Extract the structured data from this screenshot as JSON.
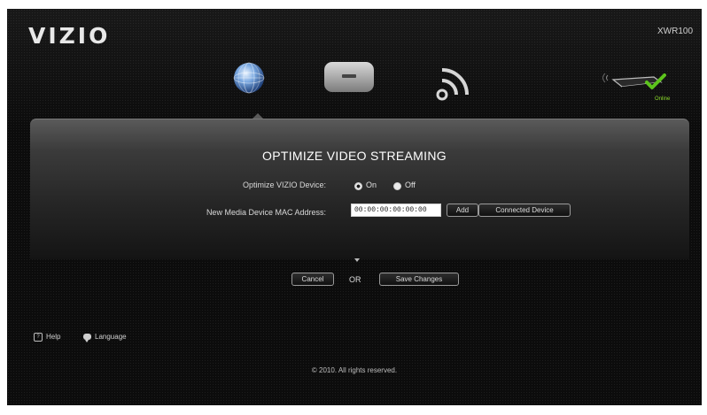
{
  "header": {
    "logo": "VIZIO",
    "model": "XWR100"
  },
  "nav": {
    "icons": [
      "globe-icon",
      "router-icon",
      "wifi-icon"
    ],
    "device_status": "Online"
  },
  "panel": {
    "title": "OPTIMIZE VIDEO STREAMING",
    "optimize_label": "Optimize VIZIO Device:",
    "optimize_options": [
      "On",
      "Off"
    ],
    "optimize_selected": "Off",
    "mac_label": "New Media Device MAC Address:",
    "mac_value": "00:00:00:00:00:00",
    "add_label": "Add",
    "connected_label": "Connected Device"
  },
  "actions": {
    "cancel_label": "Cancel",
    "or_text": "OR",
    "save_label": "Save Changes"
  },
  "footer": {
    "help_label": "Help",
    "language_label": "Language",
    "copyright": "© 2010. All rights reserved."
  },
  "colors": {
    "background": "#0c0c0c",
    "online": "#8dde2b",
    "accent_check": "#5cc31c"
  }
}
